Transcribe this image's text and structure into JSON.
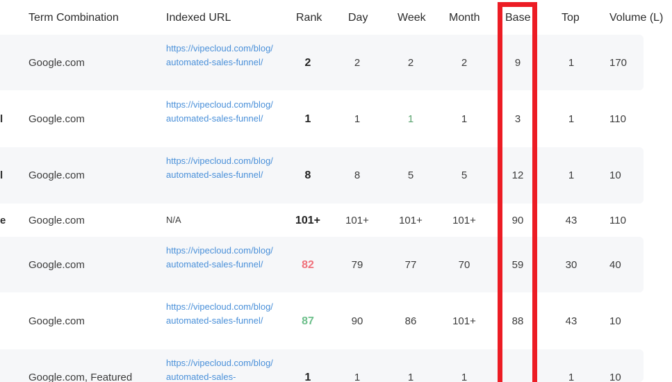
{
  "headers": {
    "term_combination": "Term Combination",
    "indexed_url": "Indexed URL",
    "rank": "Rank",
    "day": "Day",
    "week": "Week",
    "month": "Month",
    "base": "Base",
    "top": "Top",
    "volume": "Volume (L)"
  },
  "rows": [
    {
      "frag": "",
      "term": "Google.com",
      "url": "https://vipecloud.com/blog/automated-sales-funnel/",
      "rank": "2",
      "day": "2",
      "week": "2",
      "month": "2",
      "base": "9",
      "top": "1",
      "volume": "170"
    },
    {
      "frag": "l",
      "term": "Google.com",
      "url": "https://vipecloud.com/blog/automated-sales-funnel/",
      "rank": "1",
      "day": "1",
      "week": "1",
      "month": "1",
      "base": "3",
      "top": "1",
      "volume": "110"
    },
    {
      "frag": "l",
      "term": "Google.com",
      "url": "https://vipecloud.com/blog/automated-sales-funnel/",
      "rank": "8",
      "day": "8",
      "week": "5",
      "month": "5",
      "base": "12",
      "top": "1",
      "volume": "10"
    },
    {
      "frag": "e",
      "term": "Google.com",
      "url": "N/A",
      "rank": "101+",
      "day": "101+",
      "week": "101+",
      "month": "101+",
      "base": "90",
      "top": "43",
      "volume": "110"
    },
    {
      "frag": "",
      "term": "Google.com",
      "url": "https://vipecloud.com/blog/automated-sales-funnel/",
      "rank": "82",
      "day": "79",
      "week": "77",
      "month": "70",
      "base": "59",
      "top": "30",
      "volume": "40"
    },
    {
      "frag": "",
      "term": "Google.com",
      "url": "https://vipecloud.com/blog/automated-sales-funnel/",
      "rank": "87",
      "day": "90",
      "week": "86",
      "month": "101+",
      "base": "88",
      "top": "43",
      "volume": "10"
    },
    {
      "frag": "",
      "term": "Google.com, Featured",
      "url": "https://vipecloud.com/blog/automated-sales-",
      "rank": "1",
      "day": "1",
      "week": "1",
      "month": "1",
      "base": "",
      "top": "1",
      "volume": "10"
    }
  ],
  "colors": {
    "highlight": "#ec1c24",
    "link": "#4a90d9",
    "rank_down": "#f0707a",
    "rank_up": "#6dbf8b",
    "row_shade": "#f6f7f9"
  }
}
